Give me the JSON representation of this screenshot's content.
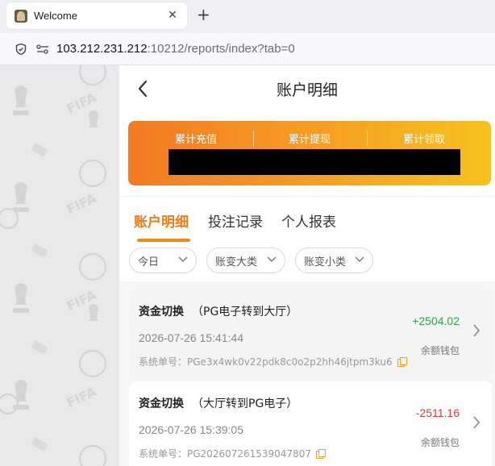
{
  "browser": {
    "tab_title": "Welcome",
    "close_glyph": "✕",
    "new_tab_glyph": "+",
    "url_host": "103.212.231.212",
    "url_rest": ":10212/reports/index?tab=0"
  },
  "header": {
    "title": "账户明细"
  },
  "summary": {
    "recharge_label": "累计充值",
    "withdraw_label": "累计提现",
    "claim_label": "累计领取"
  },
  "tabs": [
    {
      "label": "账户明细",
      "active": true
    },
    {
      "label": "投注记录",
      "active": false
    },
    {
      "label": "个人报表",
      "active": false
    }
  ],
  "filters": {
    "date": "今日",
    "major_type": "账变大类",
    "minor_type": "账变小类"
  },
  "records": [
    {
      "type": "资金切换",
      "detail": "（PG电子转到大厅）",
      "time": "2026-07-26 15:41:44",
      "order_label": "系统单号：",
      "order_no": "PGe3x4wk0v22pdk8c0o2p2hh46jtpm3ku6",
      "amount": "+2504.02",
      "wallet": "余额钱包"
    },
    {
      "type": "资金切换",
      "detail": "（大厅转到PG电子）",
      "time": "2026-07-26 15:39:05",
      "order_label": "系统单号：",
      "order_no": "PG202607261539047807",
      "amount": "-2511.16",
      "wallet": "余额钱包"
    }
  ],
  "colors": {
    "accent": "#f57a12",
    "positive": "#2aa845",
    "negative": "#e03a3a"
  }
}
